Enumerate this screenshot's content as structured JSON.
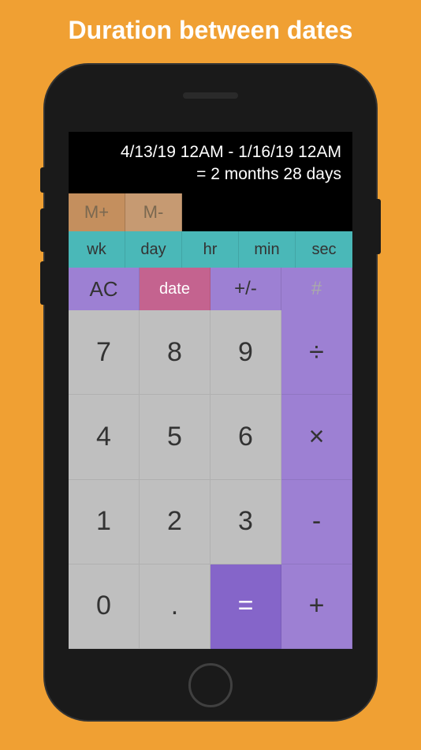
{
  "headline": "Duration between dates",
  "display": {
    "line1": "4/13/19 12AM - 1/16/19 12AM",
    "line2": "= 2 months 28 days"
  },
  "memory": {
    "plus": "M+",
    "minus": "M-"
  },
  "units": {
    "wk": "wk",
    "day": "day",
    "hr": "hr",
    "min": "min",
    "sec": "sec"
  },
  "functions": {
    "ac": "AC",
    "date": "date",
    "sign": "+/-",
    "hash": "#"
  },
  "keys": {
    "7": "7",
    "8": "8",
    "9": "9",
    "div": "÷",
    "4": "4",
    "5": "5",
    "6": "6",
    "mul": "×",
    "1": "1",
    "2": "2",
    "3": "3",
    "sub": "-",
    "0": "0",
    "dot": ".",
    "eq": "=",
    "add": "+"
  }
}
